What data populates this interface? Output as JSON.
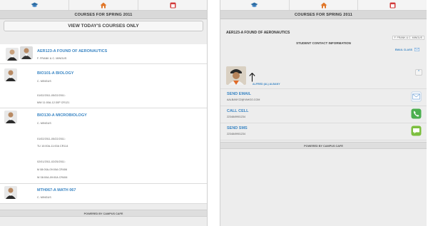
{
  "left": {
    "title": "COURSES FOR SPRING 2011",
    "view_button": "VIEW TODAY'S COURSES ONLY",
    "courses": [
      {
        "title": "AER123-A FOUND OF AERONAUTICS",
        "lines": [
          "F. FRANK & C. MINGUS"
        ]
      },
      {
        "title": "BIO101-A BIOLOGY",
        "lines": [
          "C. MINGUS",
          "01/02/2011-05/22/2011:",
          "MW 11:00A-12:30P CR121"
        ]
      },
      {
        "title": "BIO130-A MICROBIOLOGY",
        "lines": [
          "C. MINGUS",
          "01/02/2011-05/22/2011:",
          "TU 10:00A-11:00A CR114",
          "02/01/2011-02/25/2011:",
          "M 08:00A-09:00A CR406",
          "W 08:00A-09:00A CR406"
        ]
      },
      {
        "title": "MTH067-A MATH 067",
        "lines": [
          "C. MINGUS"
        ]
      }
    ],
    "footer": "POWERED BY CAMPUS CAFE"
  },
  "right": {
    "title": "COURSES FOR SPRING 2011",
    "course_title": "AER123-A FOUND OF AERONAUTICS",
    "instructors": "F. FRANK & C. MINGUS",
    "section_title": "STUDENT CONTACT INFORMATION",
    "email_class": "EMAIL CLASS",
    "student_name": "ALFRED (AL) ALBANY",
    "collapse_symbol": "^",
    "actions": [
      {
        "label": "SEND EMAIL",
        "value": "AALBANY22@YAHOO.COM",
        "icon": "envelope-icon",
        "color": "#6b9fd4"
      },
      {
        "label": "CALL CELL",
        "value": "2234849901234",
        "icon": "phone-icon",
        "color": "#4caf50"
      },
      {
        "label": "SEND SMS",
        "value": "2234849901234",
        "icon": "sms-icon",
        "color": "#7cbf3e"
      }
    ],
    "footer": "POWERED BY CAMPUS CAFE"
  },
  "colors": {
    "link": "#3b86c4",
    "background": "#ededed",
    "titlebar": "#d9d9d9"
  }
}
